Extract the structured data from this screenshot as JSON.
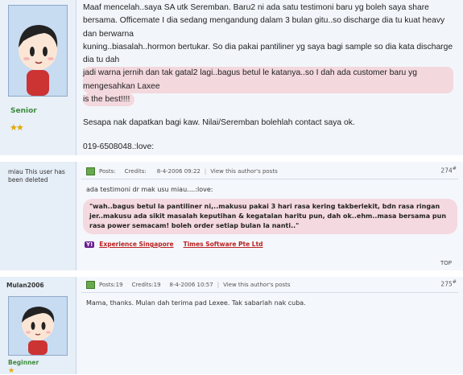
{
  "post1": {
    "rank": "Senior",
    "lines": [
      "Maaf mencelah..saya SA utk Seremban.  Baru2 ni ada satu testimoni baru yg boleh saya share",
      "bersama.  Officemate I dia sedang mengandung dalam 3 bulan gitu..so discharge dia tu kuat heavy dan berwarna",
      "kuning..biasalah..hormon bertukar.  So dia pakai pantiliner yg saya bagi sample so dia kata discharge dia tu dah",
      "jadi warna jernih dan tak gatal2 lagi..bagus betul le katanya..so I dah ada customer baru yg mengesahkan Laxee",
      "is the best!!!!"
    ],
    "contact": "Sesapa nak dapatkan bagi kaw. Nilai/Seremban bolehlah contact saya ok.",
    "phone": "019-6508048.:love:"
  },
  "post2": {
    "user_status": "miau This user has been deleted",
    "posts_label": "Posts:",
    "credits_label": "Credits:",
    "date": "8-4-2006 09:22",
    "view_posts": "View this author's posts",
    "post_number": "274",
    "intro": "ada testimoni dr mak usu miau....:love:",
    "quote": "\"wah..bagus betul la pantiliner ni,..makusu pakai 3 hari rasa kering takberlekit, bdn rasa ringan jer..makusu ada sikit masalah keputihan & kegatalan haritu pun, dah ok..ehm..masa bersama pun rasa power semacam! boleh order setiap bulan la nanti..\"",
    "ads": [
      "Experience Singapore",
      "Times Software Pte Ltd"
    ],
    "top": "TOP"
  },
  "post3": {
    "username": "Mulan2006",
    "posts_label": "Posts:19",
    "credits_label": "Credits:19",
    "date": "8-4-2006 10:57",
    "view_posts": "View this author's posts",
    "post_number": "275",
    "body": "Mama, thanks.  Mulan dah terima pad Lexee.  Tak sabarlah nak cuba.",
    "rank": "Beginner"
  }
}
